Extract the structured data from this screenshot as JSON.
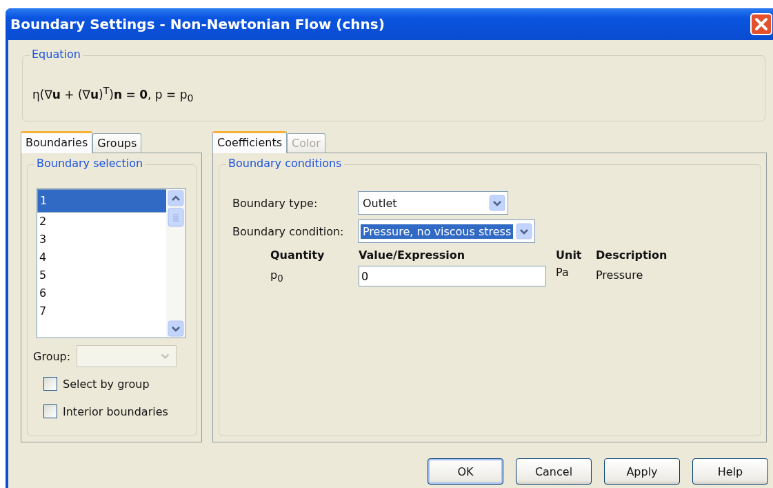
{
  "window": {
    "title": "Boundary Settings - Non-Newtonian Flow (chns)"
  },
  "equation": {
    "label": "Equation",
    "text": "η(∇**u** + (∇**u**)$^{T}$)**n** = **0**, p = p$_{0}$"
  },
  "left_tabs": [
    {
      "label": "Boundaries",
      "selected": true
    },
    {
      "label": "Groups",
      "selected": false
    }
  ],
  "boundary_selection": {
    "label": "Boundary selection",
    "items": [
      {
        "label": "1",
        "selected": true
      },
      {
        "label": "2",
        "selected": false
      },
      {
        "label": "3",
        "selected": false
      },
      {
        "label": "4",
        "selected": false
      },
      {
        "label": "5",
        "selected": false
      },
      {
        "label": "6",
        "selected": false
      },
      {
        "label": "7",
        "selected": false
      }
    ],
    "group": {
      "label": "Group:",
      "disabled": true
    },
    "checkboxes": [
      {
        "label": "Select by group",
        "checked": false
      },
      {
        "label": "Interior boundaries",
        "checked": false
      }
    ]
  },
  "right_tabs": [
    {
      "label": "Coefficients",
      "selected": true,
      "disabled": false
    },
    {
      "label": "Color",
      "selected": false,
      "disabled": true
    }
  ],
  "boundary_conditions": {
    "label": "Boundary conditions",
    "fields": [
      {
        "label": "Boundary type:",
        "value": "Outlet",
        "highlighted": false
      },
      {
        "label": "Boundary condition:",
        "value": "Pressure, no viscous stress",
        "highlighted": true
      }
    ],
    "columns": [
      "Quantity",
      "Value/Expression",
      "Unit",
      "Description"
    ],
    "rows": [
      {
        "quantity": "p$_{0}$",
        "value": "0",
        "unit": "Pa",
        "description": "Pressure"
      }
    ]
  },
  "buttons": [
    {
      "label": "OK",
      "default": true
    },
    {
      "label": "Cancel",
      "default": false
    },
    {
      "label": "Apply",
      "default": false
    },
    {
      "label": "Help",
      "default": false
    }
  ]
}
